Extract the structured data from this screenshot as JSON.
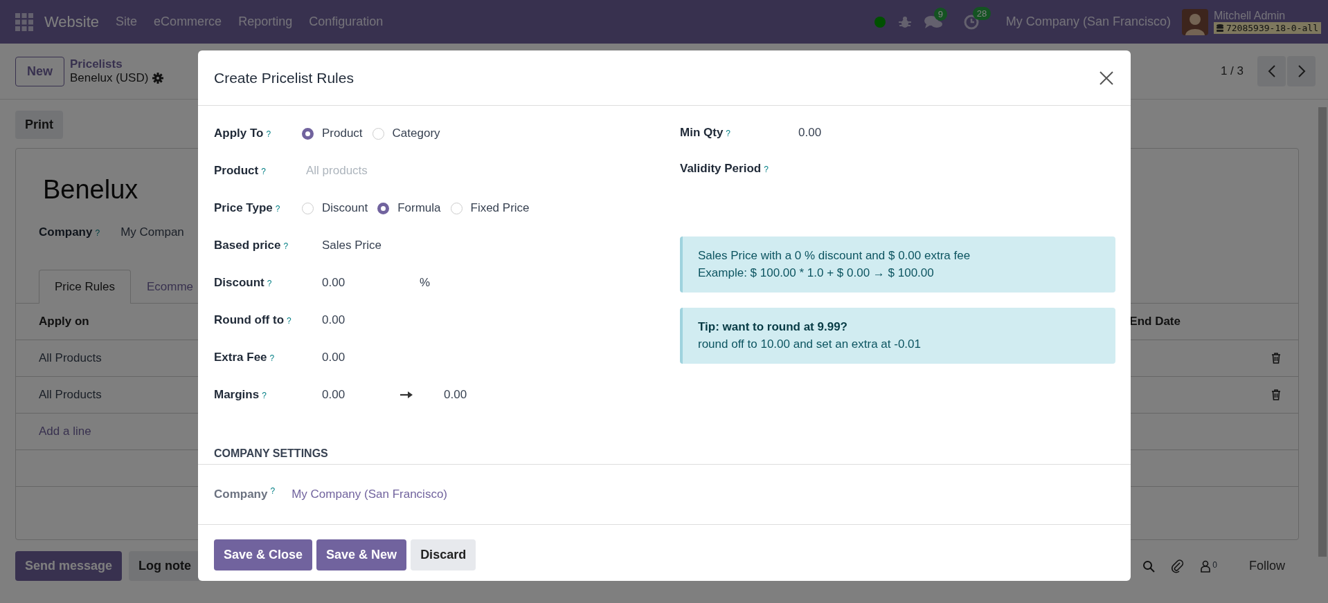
{
  "navbar": {
    "app": "Website",
    "menu": [
      "Site",
      "eCommerce",
      "Reporting",
      "Configuration"
    ],
    "messages_count": "9",
    "activities_count": "28",
    "company": "My Company (San Francisco)",
    "user": "Mitchell Admin",
    "database": "72085939-18-0-all"
  },
  "control_panel": {
    "new_button": "New",
    "breadcrumb": "Pricelists",
    "record": "Benelux (USD)",
    "pager": "1 / 3"
  },
  "action_button": "Print",
  "record": {
    "name": "Benelux",
    "company_label": "Company",
    "company_help": "?",
    "company_value": "My Compan",
    "tabs": [
      {
        "label": "Price Rules",
        "selected": true
      },
      {
        "label": "Ecomme",
        "selected": false
      }
    ],
    "columns": [
      "Apply on",
      "End Date"
    ],
    "rows": [
      "All Products",
      "All Products"
    ],
    "add_line": "Add a line"
  },
  "chatter": {
    "buttons": [
      "Send message",
      "Log note"
    ],
    "followers_count": "0",
    "follow": "Follow"
  },
  "dialog": {
    "title": "Create Pricelist Rules",
    "left_fields": [
      {
        "label": "Apply To",
        "help": "?",
        "kind": "radio",
        "options": [
          {
            "label": "Product",
            "selected": true
          },
          {
            "label": "Category",
            "selected": false
          }
        ]
      },
      {
        "label": "Product",
        "help": "?",
        "kind": "text",
        "placeholder": "All products"
      },
      {
        "label": "Price Type",
        "help": "?",
        "kind": "radio",
        "options": [
          {
            "label": "Discount",
            "selected": false
          },
          {
            "label": "Formula",
            "selected": true
          },
          {
            "label": "Fixed Price",
            "selected": false
          }
        ]
      },
      {
        "label": "Based price",
        "help": "?",
        "kind": "text",
        "value": "Sales Price"
      },
      {
        "label": "Discount",
        "help": "?",
        "kind": "unit",
        "value": "0.00",
        "unit": "%"
      },
      {
        "label": "Round off to",
        "help": "?",
        "kind": "text",
        "value": "0.00"
      },
      {
        "label": "Extra Fee",
        "help": "?",
        "kind": "text",
        "value": "0.00"
      },
      {
        "label": "Margins",
        "help": "?",
        "kind": "range",
        "value": "0.00",
        "value_to": "0.00"
      }
    ],
    "right_fields": [
      {
        "label": "Min Qty",
        "help": "?",
        "kind": "text",
        "value": "0.00"
      },
      {
        "label": "Validity Period",
        "help": "?",
        "kind": "text"
      }
    ],
    "alerts": [
      {
        "lines": [
          "Sales Price with a 0 % discount and $ 0.00 extra fee",
          "Example: $ 100.00 * 1.0 + $ 0.00 → $ 100.00"
        ]
      },
      {
        "title": "Tip: want to round at 9.99?",
        "lines": [
          "round off to 10.00 and set an extra at -0.01"
        ]
      }
    ],
    "section": "COMPANY SETTINGS",
    "company": {
      "label": "Company",
      "help": "?",
      "value": "My Company (San Francisco)"
    },
    "buttons": [
      {
        "label": "Save & Close",
        "kind": "primary"
      },
      {
        "label": "Save & New",
        "kind": "primary"
      },
      {
        "label": "Discard",
        "kind": "secondary"
      }
    ]
  }
}
